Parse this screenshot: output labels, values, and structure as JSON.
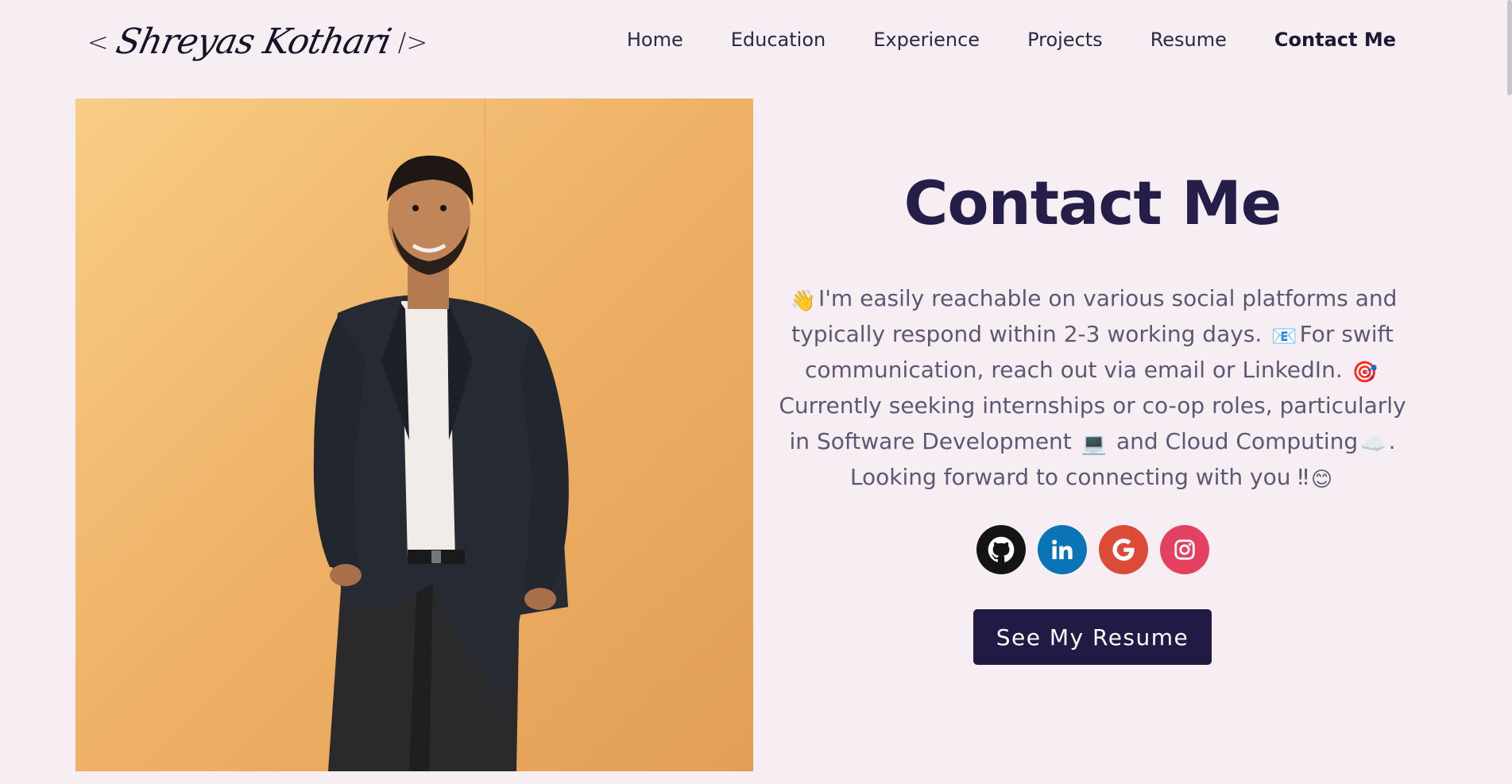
{
  "header": {
    "logo": {
      "open": "<",
      "name": "Shreyas Kothari",
      "close": "/>"
    },
    "nav": [
      {
        "label": "Home",
        "active": false
      },
      {
        "label": "Education",
        "active": false
      },
      {
        "label": "Experience",
        "active": false
      },
      {
        "label": "Projects",
        "active": false
      },
      {
        "label": "Resume",
        "active": false
      },
      {
        "label": "Contact Me",
        "active": true
      }
    ]
  },
  "main": {
    "title": "Contact Me",
    "description": {
      "emoji_wave": "👋",
      "text1": "I'm easily reachable on various social platforms and typically respond within 2-3 working days.",
      "emoji_mail": "📧",
      "text2": "For swift communication, reach out via email or LinkedIn.",
      "emoji_target": "🎯",
      "text3": "Currently seeking internships or co-op roles, particularly in Software Development",
      "emoji_laptop": "💻",
      "text4": "and Cloud Computing",
      "emoji_cloud": "☁️",
      "text5": ". Looking forward to connecting with you",
      "text6": "‼",
      "emoji_smile": "😊"
    },
    "socials": [
      {
        "name": "github",
        "icon": "github-icon",
        "color": "#141414"
      },
      {
        "name": "linkedin",
        "icon": "linkedin-icon",
        "color": "#0a74b6"
      },
      {
        "name": "google",
        "icon": "google-icon",
        "color": "#dc4a38"
      },
      {
        "name": "instagram",
        "icon": "instagram-icon",
        "color": "#e4405f"
      }
    ],
    "resume_button": "See My Resume"
  },
  "colors": {
    "background": "#f6eef3",
    "accent": "#201a44",
    "text": "#5c5873"
  }
}
